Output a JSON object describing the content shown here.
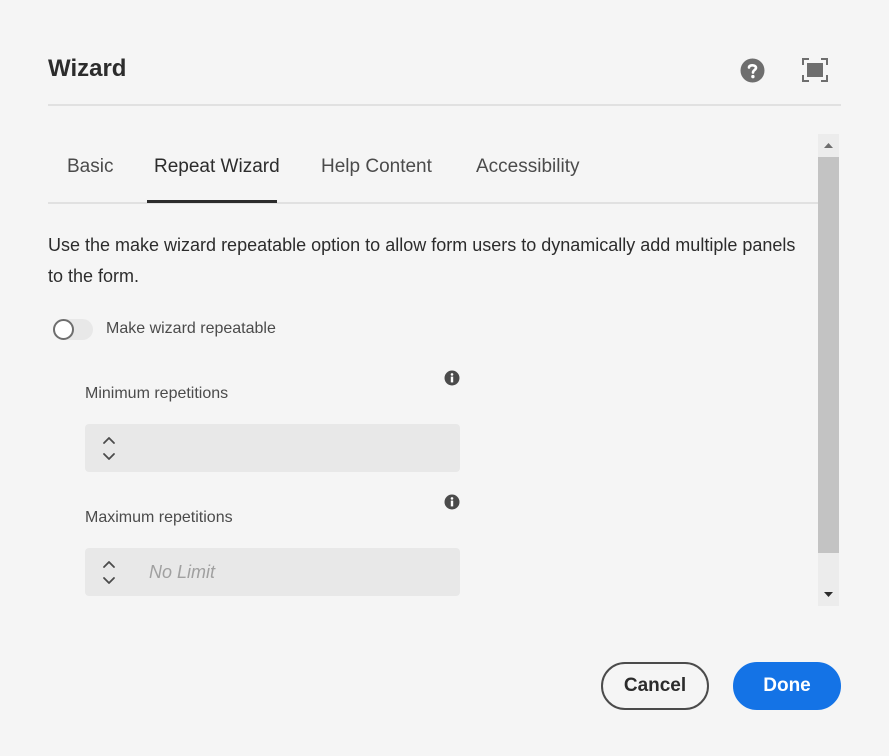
{
  "dialog": {
    "title": "Wizard",
    "help_icon": "help-circle-icon",
    "fullscreen_icon": "fullscreen-icon"
  },
  "tabs": [
    {
      "label": "Basic",
      "active": false
    },
    {
      "label": "Repeat Wizard",
      "active": true
    },
    {
      "label": "Help Content",
      "active": false
    },
    {
      "label": "Accessibility",
      "active": false
    }
  ],
  "repeat": {
    "description": "Use the make wizard repeatable option to allow form users to dynamically add multiple panels to the form.",
    "toggle_label": "Make wizard repeatable",
    "toggle_on": false,
    "min_label": "Minimum repetitions",
    "min_value": "",
    "min_placeholder": "",
    "max_label": "Maximum repetitions",
    "max_value": "",
    "max_placeholder": "No Limit"
  },
  "footer": {
    "cancel_label": "Cancel",
    "done_label": "Done"
  },
  "colors": {
    "background": "#f5f5f5",
    "primary_button": "#1473e6",
    "text": "#2c2c2c",
    "field_bg": "#e8e8e8"
  }
}
